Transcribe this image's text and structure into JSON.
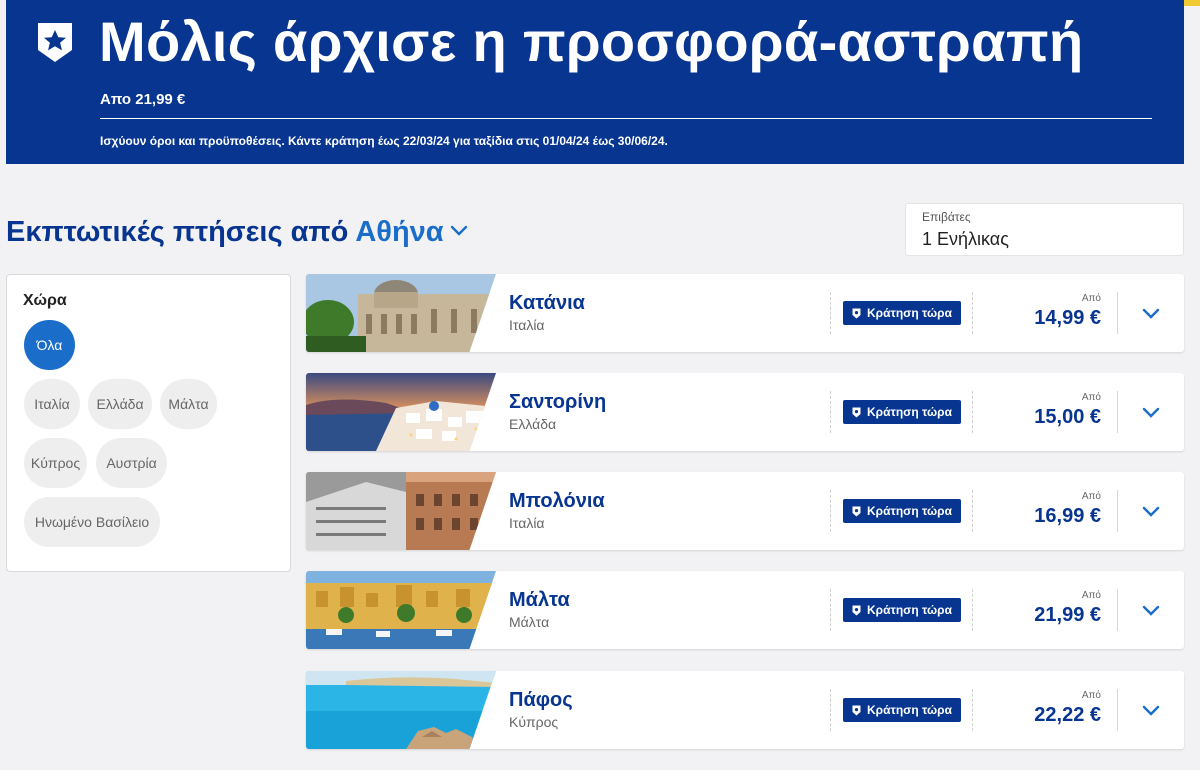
{
  "colors": {
    "brand_navy": "#073590",
    "accent_blue": "#1a6ec9",
    "yellow": "#f1c933"
  },
  "banner": {
    "badge_icon": "star-shield-icon",
    "title": "Μόλις άρχισε η προσφορά-αστραπή",
    "from_price": "Απο 21,99 €",
    "terms": "Ισχύουν όροι και προϋποθέσεις. Κάντε κράτηση έως 22/03/24 για ταξίδια στις 01/04/24 έως 30/06/24."
  },
  "heading": {
    "prefix": "Εκπτωτικές πτήσεις από ",
    "city": "Αθήνα",
    "icon": "chevron-down-icon"
  },
  "passengers": {
    "label": "Επιβάτες",
    "value": "1 Ενήλικας"
  },
  "filter": {
    "label": "Χώρα",
    "chips": [
      "Όλα",
      "Ιταλία",
      "Ελλάδα",
      "Μάλτα",
      "Κύπρος",
      "Αυστρία",
      "Ηνωμένο Βασίλειο"
    ],
    "selected": "Όλα"
  },
  "destinations": [
    {
      "city": "Κατάνια",
      "country": "Ιταλία",
      "book_label": "Κράτηση τώρα",
      "from_label": "Από",
      "price": "14,99 €"
    },
    {
      "city": "Σαντορίνη",
      "country": "Ελλάδα",
      "book_label": "Κράτηση τώρα",
      "from_label": "Από",
      "price": "15,00 €"
    },
    {
      "city": "Μπολόνια",
      "country": "Ιταλία",
      "book_label": "Κράτηση τώρα",
      "from_label": "Από",
      "price": "16,99 €"
    },
    {
      "city": "Μάλτα",
      "country": "Μάλτα",
      "book_label": "Κράτηση τώρα",
      "from_label": "Από",
      "price": "21,99 €"
    },
    {
      "city": "Πάφος",
      "country": "Κύπρος",
      "book_label": "Κράτηση τώρα",
      "from_label": "Από",
      "price": "22,22 €"
    }
  ]
}
